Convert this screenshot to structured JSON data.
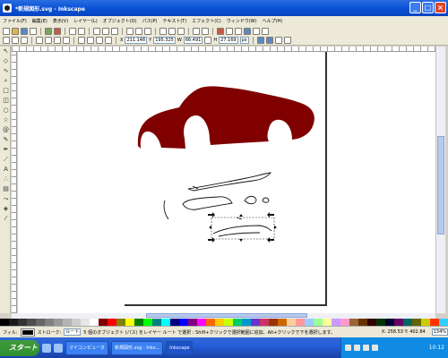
{
  "window": {
    "title": "*新規図形.svg - Inkscape",
    "buttons": [
      "_",
      "□",
      "×"
    ]
  },
  "menu": {
    "items": [
      "ファイル(F)",
      "編集(E)",
      "表示(V)",
      "レイヤー(L)",
      "オブジェクト(O)",
      "パス(P)",
      "テキスト(T)",
      "エフェクト(C)",
      "ウィンドウ(W)",
      "ヘルプ(H)"
    ]
  },
  "toolbar2": {
    "x_label": "X",
    "x_value": "211.148",
    "y_label": "Y",
    "y_value": "195.325",
    "w_label": "W",
    "w_value": "66.491",
    "h_label": "H",
    "h_value": "27.169",
    "unit": "px"
  },
  "canvas": {
    "car_color": "#800000"
  },
  "status": {
    "fill_label": "フィル:",
    "stroke_label": "ストローク:",
    "layer_value": "ルート",
    "message": "5 個のオブジェクト (パス) をレイヤー ルート で選択 : Shift+クリックで選択範囲に追加、Alt+クリックで下を選択します。",
    "zoom": "134%",
    "coords": "X: 258.53  Y: 402.84"
  },
  "palette": [
    "#000000",
    "#1a1a1a",
    "#333333",
    "#4d4d4d",
    "#666666",
    "#808080",
    "#999999",
    "#b3b3b3",
    "#cccccc",
    "#e6e6e6",
    "#ffffff",
    "#800000",
    "#ff0000",
    "#808000",
    "#ffff00",
    "#008000",
    "#00ff00",
    "#008080",
    "#00ffff",
    "#000080",
    "#0000ff",
    "#800080",
    "#ff00ff",
    "#ff6600",
    "#ffcc00",
    "#ccff00",
    "#00cc66",
    "#0099cc",
    "#6633cc",
    "#cc3366",
    "#993300",
    "#cc6600",
    "#ffcc99",
    "#ff9999",
    "#99ccff",
    "#99ff99",
    "#ffff99",
    "#cc99ff",
    "#ff99cc",
    "#996633",
    "#663300",
    "#330000",
    "#003300",
    "#000033",
    "#660066",
    "#006666",
    "#666600",
    "#cccc00",
    "#ff3300",
    "#33ccff"
  ],
  "taskbar": {
    "start_label": "スタート",
    "items": [
      "マイコンピュータ",
      "新規図形.svg - Inks...",
      "Inkscape"
    ],
    "clock": "10:12"
  }
}
